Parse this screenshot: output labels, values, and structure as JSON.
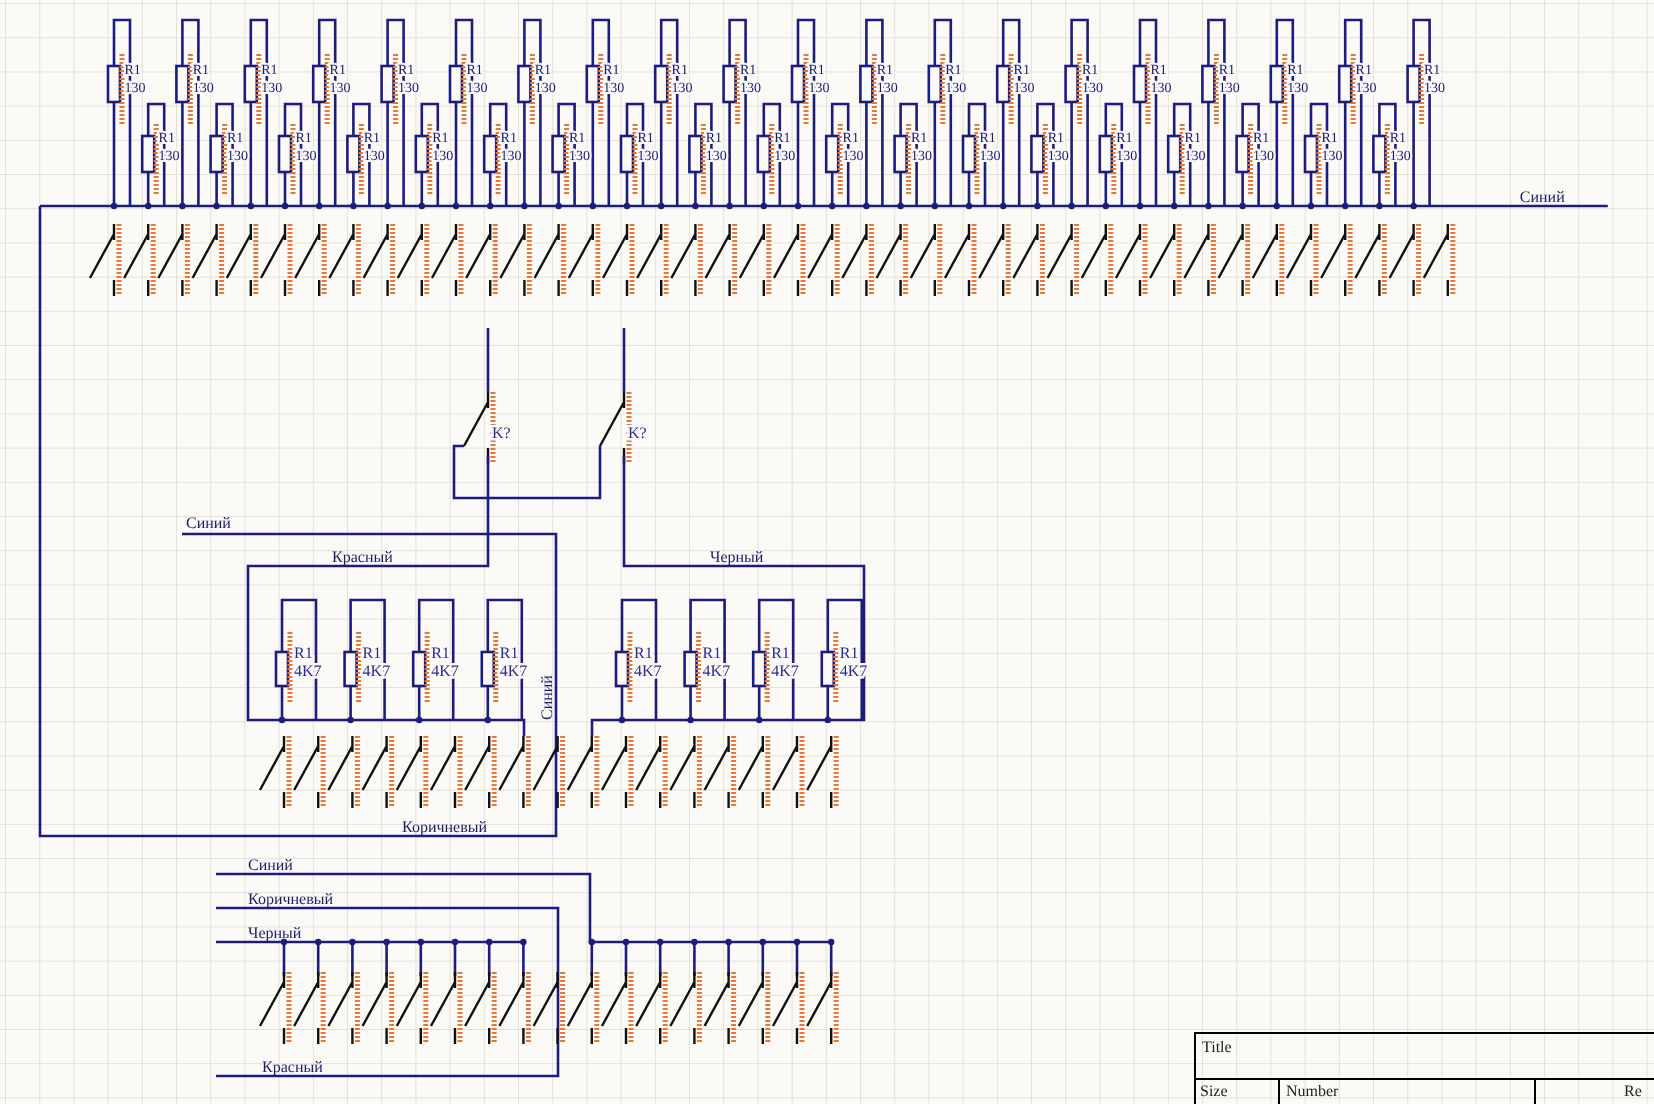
{
  "top_bank": {
    "net_label": "Синий",
    "resistors": [
      {
        "ref": "R1",
        "value": "130"
      },
      {
        "ref": "R1",
        "value": "130"
      },
      {
        "ref": "R1",
        "value": "130"
      },
      {
        "ref": "R1",
        "value": "130"
      },
      {
        "ref": "R1",
        "value": "130"
      },
      {
        "ref": "R1",
        "value": "130"
      },
      {
        "ref": "R1",
        "value": "130"
      },
      {
        "ref": "R1",
        "value": "130"
      },
      {
        "ref": "R1",
        "value": "130"
      },
      {
        "ref": "R1",
        "value": "130"
      },
      {
        "ref": "R1",
        "value": "130"
      },
      {
        "ref": "R1",
        "value": "130"
      },
      {
        "ref": "R1",
        "value": "130"
      },
      {
        "ref": "R1",
        "value": "130"
      },
      {
        "ref": "R1",
        "value": "130"
      },
      {
        "ref": "R1",
        "value": "130"
      },
      {
        "ref": "R1",
        "value": "130"
      },
      {
        "ref": "R1",
        "value": "130"
      },
      {
        "ref": "R1",
        "value": "130"
      },
      {
        "ref": "R1",
        "value": "130"
      },
      {
        "ref": "R1",
        "value": "130"
      },
      {
        "ref": "R1",
        "value": "130"
      },
      {
        "ref": "R1",
        "value": "130"
      },
      {
        "ref": "R1",
        "value": "130"
      },
      {
        "ref": "R1",
        "value": "130"
      },
      {
        "ref": "R1",
        "value": "130"
      },
      {
        "ref": "R1",
        "value": "130"
      },
      {
        "ref": "R1",
        "value": "130"
      },
      {
        "ref": "R1",
        "value": "130"
      },
      {
        "ref": "R1",
        "value": "130"
      },
      {
        "ref": "R1",
        "value": "130"
      },
      {
        "ref": "R1",
        "value": "130"
      },
      {
        "ref": "R1",
        "value": "130"
      },
      {
        "ref": "R1",
        "value": "130"
      },
      {
        "ref": "R1",
        "value": "130"
      },
      {
        "ref": "R1",
        "value": "130"
      },
      {
        "ref": "R1",
        "value": "130"
      },
      {
        "ref": "R1",
        "value": "130"
      },
      {
        "ref": "R1",
        "value": "130"
      }
    ]
  },
  "relays": [
    {
      "ref": "K?"
    },
    {
      "ref": "K?"
    }
  ],
  "middle_nets": {
    "left_feed": "Синий",
    "left_bus": "Красный",
    "right_bus": "Черный",
    "vertical_feed": "Синий",
    "return": "Коричневый"
  },
  "middle_bank": {
    "resistors": [
      {
        "ref": "R1",
        "value": "4K7"
      },
      {
        "ref": "R1",
        "value": "4K7"
      },
      {
        "ref": "R1",
        "value": "4K7"
      },
      {
        "ref": "R1",
        "value": "4K7"
      },
      {
        "ref": "R1",
        "value": "4K7"
      },
      {
        "ref": "R1",
        "value": "4K7"
      },
      {
        "ref": "R1",
        "value": "4K7"
      },
      {
        "ref": "R1",
        "value": "4K7"
      }
    ]
  },
  "bottom_nets": [
    {
      "label": "Синий"
    },
    {
      "label": "Коричневый"
    },
    {
      "label": "Черный"
    },
    {
      "label": "Красный"
    }
  ],
  "title_block": {
    "title_label": "Title",
    "size_label": "Size",
    "number_label": "Number",
    "rev_label": "Re"
  }
}
